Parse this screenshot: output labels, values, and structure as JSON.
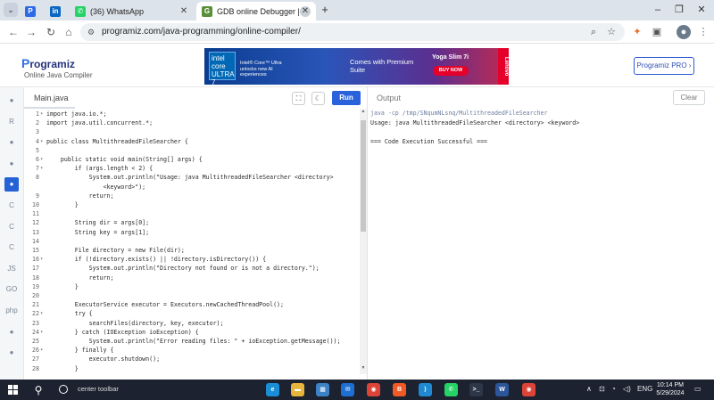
{
  "browser": {
    "tabs": [
      {
        "title": "",
        "fav": "P",
        "favColor": "#2e6be6",
        "active": false
      },
      {
        "title": "",
        "fav": "in",
        "favColor": "#0a66c2",
        "active": false
      },
      {
        "title": "(36) WhatsApp",
        "fav": "✆",
        "favColor": "#25d366",
        "active": false
      },
      {
        "title": "GDB online Debugger | Compi",
        "fav": "G",
        "favColor": "#5a8f3a",
        "active": true
      }
    ],
    "url": "programiz.com/java-programming/online-compiler/"
  },
  "site": {
    "logo": "Programiz",
    "logo_sub": "Online Java Compiler",
    "pro_button": "Programiz PRO ›",
    "ad": {
      "chip_label": "intel core ULTRA 7",
      "line1": "Intel® Core™ Ultra unlocks new AI experiences",
      "line2": "Comes with Premium Suite",
      "product": "Yoga Slim 7i",
      "cta": "BUY NOW",
      "brand": "Lenovo"
    }
  },
  "sidebar": {
    "icons": [
      "python-icon",
      "r-icon",
      "sql-icon",
      "html-icon",
      "java-icon",
      "c-icon",
      "cpp-icon",
      "csharp-icon",
      "js-icon",
      "go-icon",
      "php-icon",
      "swift-icon",
      "rust-icon"
    ],
    "labels": [
      "",
      "R",
      "",
      "",
      "",
      "C",
      "C",
      "C",
      "JS",
      "GO",
      "php",
      "",
      ""
    ],
    "active_index": 4
  },
  "editor": {
    "file_tab": "Main.java",
    "run_label": "Run",
    "lines": [
      {
        "n": "1",
        "f": "▾",
        "t": "import java.io.*;"
      },
      {
        "n": "2",
        "f": "",
        "t": "import java.util.concurrent.*;"
      },
      {
        "n": "3",
        "f": "",
        "t": ""
      },
      {
        "n": "4",
        "f": "▾",
        "t": "public class MultithreadedFileSearcher {"
      },
      {
        "n": "5",
        "f": "",
        "t": ""
      },
      {
        "n": "6",
        "f": "▾",
        "t": "    public static void main(String[] args) {"
      },
      {
        "n": "7",
        "f": "▾",
        "t": "        if (args.length < 2) {"
      },
      {
        "n": "8",
        "f": "",
        "t": "            System.out.println(\"Usage: java MultithreadedFileSearcher <directory>"
      },
      {
        "n": "",
        "f": "",
        "t": "                <keyword>\");"
      },
      {
        "n": "9",
        "f": "",
        "t": "            return;"
      },
      {
        "n": "10",
        "f": "",
        "t": "        }"
      },
      {
        "n": "11",
        "f": "",
        "t": ""
      },
      {
        "n": "12",
        "f": "",
        "t": "        String dir = args[0];"
      },
      {
        "n": "13",
        "f": "",
        "t": "        String key = args[1];"
      },
      {
        "n": "14",
        "f": "",
        "t": ""
      },
      {
        "n": "15",
        "f": "",
        "t": "        File directory = new File(dir);"
      },
      {
        "n": "16",
        "f": "▾",
        "t": "        if (!directory.exists() || !directory.isDirectory()) {"
      },
      {
        "n": "17",
        "f": "",
        "t": "            System.out.println(\"Directory not found or is not a directory.\");"
      },
      {
        "n": "18",
        "f": "",
        "t": "            return;"
      },
      {
        "n": "19",
        "f": "",
        "t": "        }"
      },
      {
        "n": "20",
        "f": "",
        "t": ""
      },
      {
        "n": "21",
        "f": "",
        "t": "        ExecutorService executor = Executors.newCachedThreadPool();"
      },
      {
        "n": "22",
        "f": "▾",
        "t": "        try {"
      },
      {
        "n": "23",
        "f": "",
        "t": "            searchFiles(directory, key, executor);"
      },
      {
        "n": "24",
        "f": "▾",
        "t": "        } catch (IOException ioException) {"
      },
      {
        "n": "25",
        "f": "",
        "t": "            System.out.println(\"Error reading files: \" + ioException.getMessage());"
      },
      {
        "n": "26",
        "f": "▾",
        "t": "        } finally {"
      },
      {
        "n": "27",
        "f": "",
        "t": "            executor.shutdown();"
      },
      {
        "n": "28",
        "f": "",
        "t": "        }"
      }
    ]
  },
  "output": {
    "title": "Output",
    "clear_label": "Clear",
    "lines": [
      {
        "t": "java -cp /tmp/SNqumNLsnq/MultithreadedFileSearcher",
        "cmd": true
      },
      {
        "t": "Usage: java MultithreadedFileSearcher <directory> <keyword>",
        "cmd": false
      },
      {
        "t": "",
        "cmd": false
      },
      {
        "t": "=== Code Execution Successful ===",
        "cmd": false
      }
    ]
  },
  "taskbar": {
    "search_label": "center toolbar",
    "tray_lang": "ENG",
    "time": "10:14 PM",
    "date": "5/29/2024",
    "apps": [
      {
        "name": "edge-app",
        "label": "e",
        "color": "#1a8fd8"
      },
      {
        "name": "file-explorer-app",
        "label": "▬",
        "color": "#e7b53c"
      },
      {
        "name": "store-app",
        "label": "▦",
        "color": "#3b82c6"
      },
      {
        "name": "mail-app",
        "label": "✉",
        "color": "#1d6fd1"
      },
      {
        "name": "chrome-app",
        "label": "◉",
        "color": "#db4437"
      },
      {
        "name": "brave-app",
        "label": "B",
        "color": "#f15a24"
      },
      {
        "name": "vscode-app",
        "label": "⟩",
        "color": "#1f8ad2"
      },
      {
        "name": "whatsapp-app",
        "label": "✆",
        "color": "#25d366"
      },
      {
        "name": "terminal-app",
        "label": ">_",
        "color": "#2d3748"
      },
      {
        "name": "word-app",
        "label": "W",
        "color": "#2b579a"
      },
      {
        "name": "chrome-active-app",
        "label": "◉",
        "color": "#db4437"
      }
    ]
  }
}
